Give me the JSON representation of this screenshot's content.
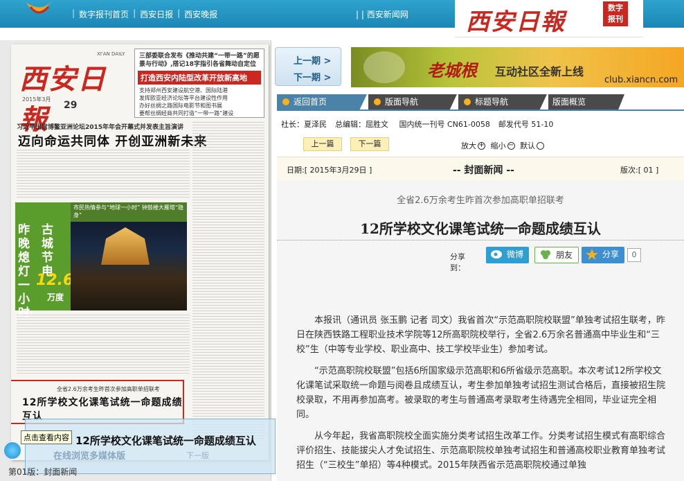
{
  "header": {
    "nav": [
      "数字报刊首页",
      "西安日报",
      "西安晚报"
    ],
    "nav_right": "西安新闻网",
    "brand_title": "西安日報",
    "brand_badge_line1": "数字",
    "brand_badge_line2": "报刊"
  },
  "paper": {
    "masthead_title": "西安日報",
    "masthead_eng": "XI'AN DAILY",
    "masthead_date": "2015年3月",
    "masthead_day": "29",
    "topbox_line": "三部委联合发布《推动共建“一带一路”的愿景与行动》,搭记18字指引各省舞动自定位",
    "topbox_red": "打造西安内陆型改革开放新高地",
    "topbox_items": [
      "支持郑州西安建设航空港、国际陆港",
      "发挥欧亚经济论坛等平台建设性作用",
      "办好丝绸之路国际电影节和图书展",
      "要帮丝绸经商共同打造“一带一路”建设"
    ],
    "lead_small": "习近平出席博鳌亚洲论坛2015年年会开幕式并发表主旨演讲",
    "lead_big": "迈向命运共同体 开创亚洲新未来",
    "green_top": "市民热情参与“地球一小时” 钟鼓楼大雁塔“隐身”",
    "green_left": "昨晚熄灯一小时",
    "green_right": "古城节电",
    "green_num": "12.6",
    "green_unit": "万度",
    "hl_sub": "全省2.6万余考生昨首次参加高职单招联考",
    "hl_main": "12所学校文化课笔试统一命题成绩互认"
  },
  "overlay": {
    "tooltip": "点击查看内容",
    "hover_title": "12所学校文化课笔试统一命题成绩互认",
    "hover_sub": "在线浏览多媒体版",
    "hover_next": "下一版",
    "page_label": "第01版：封面新闻"
  },
  "pager": {
    "prev": "上一期 >",
    "next": "下一期 >"
  },
  "banner": {
    "big": "老城根",
    "rest": "互动社区全新上线",
    "url": "club.xiancn.com"
  },
  "tabs": [
    "返回首页",
    "版面导航",
    "标题导航",
    "版面概览"
  ],
  "meta": {
    "president": "社长：夏泽民",
    "editor": "总编辑：屈胜文",
    "cn": "国内统一刊号 CN61-0058",
    "post": "邮发代号 51-10"
  },
  "controls": {
    "prev_article": "上一篇",
    "next_article": "下一篇",
    "zoom_in": "放大",
    "zoom_out": "缩小",
    "default": "默认"
  },
  "datebar": {
    "date": "日期:[ 2015年3月29日 ]",
    "section": "-- 封面新闻 --",
    "version": "版次:[ 01 ]"
  },
  "article": {
    "subtitle": "全省2.6万余考生昨首次参加高职单招联考",
    "title": "12所学校文化课笔试统一命题成绩互认",
    "share_label": "分享到：",
    "share_weibo": "微博",
    "share_pengyou": "朋友",
    "share_fx": "分享",
    "share_count": "0",
    "paragraphs": [
      "本报讯（通讯员 张玉鹏 记者 司文）我省首次“示范高职院校联盟”单独考试招生联考，昨日在陕西铁路工程职业技术学院等12所高职院校举行，全省2.6万余名普通高中毕业生和“三校”生（中等专业学校、职业高中、技工学校毕业生）参加考试。",
      "“示范高职院校联盟”包括6所国家级示范高职和6所省级示范高职。本次考试12所学校文化课笔试采取统一命题与阅卷且成绩互认，考生参加单独考试招生测试合格后，直接被招生院校录取，不用再参加高考。被录取的考生与普通高考录取考生待遇完全相同，毕业证完全相同。",
      "从今年起，我省高职院校全面实施分类考试招生改革工作。分类考试招生模式有高职综合评价招生、技能拔尖人才免试招生、示范高职院校单独考试招生和普通高校职业教育单独考试招生（“三校生”单招）等4种模式。2015年陕西省示范高职院校通过单独"
    ]
  }
}
